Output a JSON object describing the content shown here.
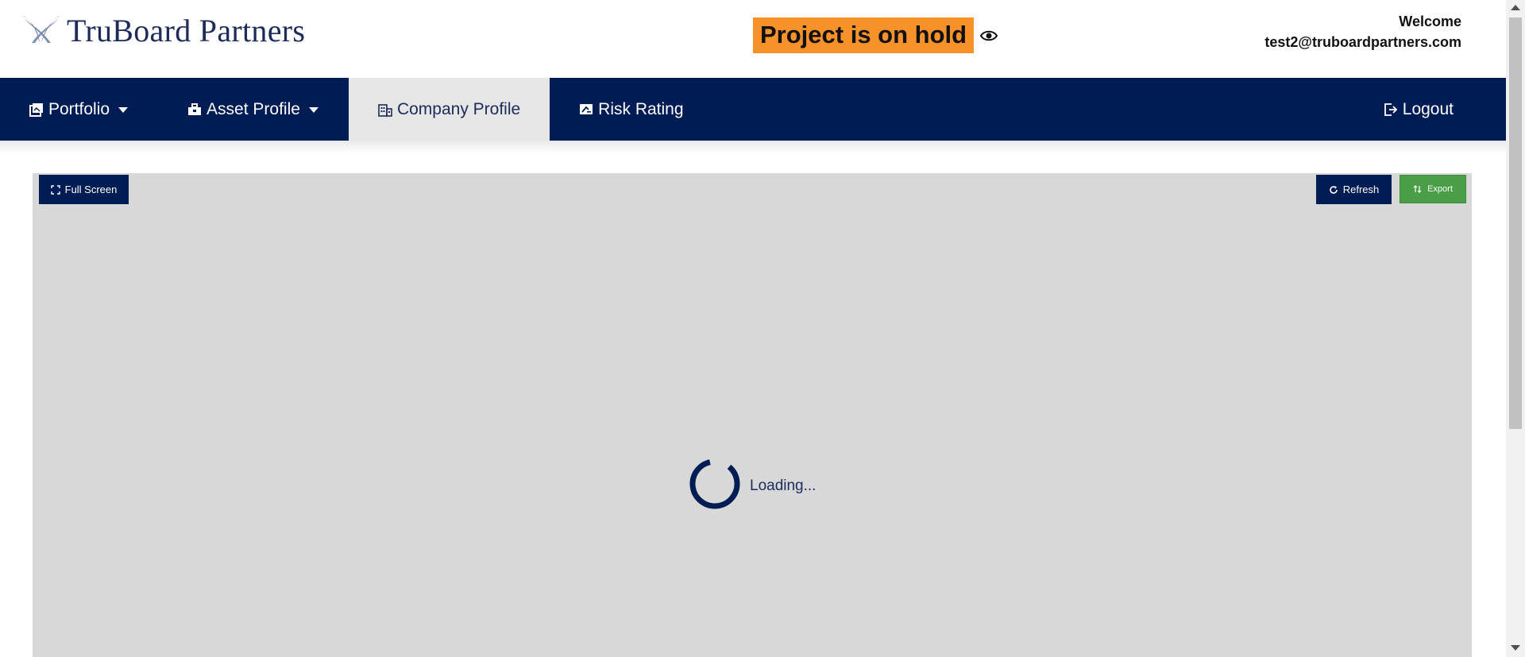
{
  "header": {
    "logo_text": "TruBoard Partners",
    "status_badge": "Project is on hold",
    "welcome_label": "Welcome",
    "user_email": "test2@truboardpartners.com"
  },
  "nav": {
    "items": [
      {
        "label": "Portfolio",
        "icon": "portfolio-icon",
        "dropdown": true
      },
      {
        "label": "Asset Profile",
        "icon": "briefcase-icon",
        "dropdown": true
      },
      {
        "label": "Company Profile",
        "icon": "building-icon",
        "active": true
      },
      {
        "label": "Risk Rating",
        "icon": "rating-icon"
      }
    ],
    "logout_label": "Logout"
  },
  "toolbar": {
    "fullscreen_label": "Full Screen",
    "refresh_label": "Refresh",
    "export_label": "Export"
  },
  "loader": {
    "text": "Loading..."
  },
  "colors": {
    "nav_bg": "#001c54",
    "badge_bg": "#f7912a",
    "export_bg": "#4a9e47",
    "panel_bg": "#d8d8d8",
    "active_tab_bg": "#e6e6e6"
  }
}
